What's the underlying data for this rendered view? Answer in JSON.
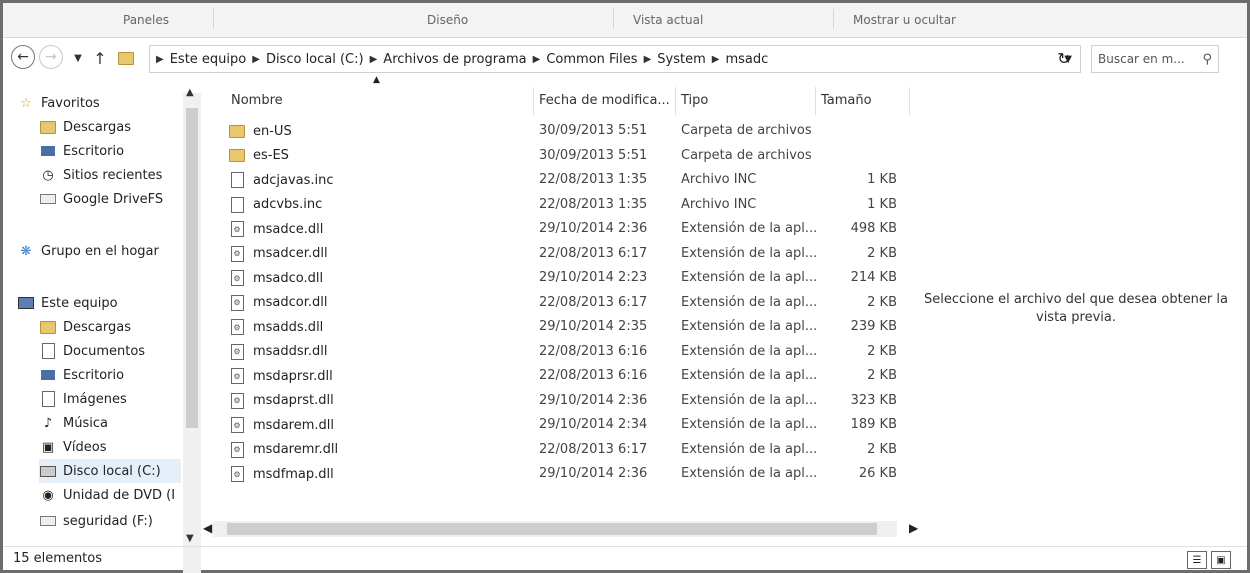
{
  "ribbon": {
    "groups": [
      "Paneles",
      "Diseño",
      "Vista actual",
      "Mostrar u ocultar"
    ]
  },
  "address": {
    "segments": [
      "Este equipo",
      "Disco local (C:)",
      "Archivos de programa",
      "Common Files",
      "System",
      "msadc"
    ],
    "search_placeholder": "Buscar en m..."
  },
  "sidebar": {
    "favorites_label": "Favoritos",
    "favorites": [
      "Descargas",
      "Escritorio",
      "Sitios recientes",
      "Google DriveFS"
    ],
    "homegroup_label": "Grupo en el hogar",
    "pc_label": "Este equipo",
    "pc_items": [
      "Descargas",
      "Documentos",
      "Escritorio",
      "Imágenes",
      "Música",
      "Vídeos",
      "Disco local (C:)",
      "Unidad de DVD (I",
      "seguridad (F:)"
    ]
  },
  "columns": {
    "name": "Nombre",
    "date": "Fecha de modifica...",
    "type": "Tipo",
    "size": "Tamaño"
  },
  "files": [
    {
      "name": "en-US",
      "date": "30/09/2013 5:51",
      "type": "Carpeta de archivos",
      "size": "",
      "icon": "folder-icon"
    },
    {
      "name": "es-ES",
      "date": "30/09/2013 5:51",
      "type": "Carpeta de archivos",
      "size": "",
      "icon": "folder-icon"
    },
    {
      "name": "adcjavas.inc",
      "date": "22/08/2013 1:35",
      "type": "Archivo INC",
      "size": "1 KB",
      "icon": "file-icon"
    },
    {
      "name": "adcvbs.inc",
      "date": "22/08/2013 1:35",
      "type": "Archivo INC",
      "size": "1 KB",
      "icon": "file-icon"
    },
    {
      "name": "msadce.dll",
      "date": "29/10/2014 2:36",
      "type": "Extensión de la apl...",
      "size": "498 KB",
      "icon": "dll-icon"
    },
    {
      "name": "msadcer.dll",
      "date": "22/08/2013 6:17",
      "type": "Extensión de la apl...",
      "size": "2 KB",
      "icon": "dll-icon"
    },
    {
      "name": "msadco.dll",
      "date": "29/10/2014 2:23",
      "type": "Extensión de la apl...",
      "size": "214 KB",
      "icon": "dll-icon"
    },
    {
      "name": "msadcor.dll",
      "date": "22/08/2013 6:17",
      "type": "Extensión de la apl...",
      "size": "2 KB",
      "icon": "dll-icon"
    },
    {
      "name": "msadds.dll",
      "date": "29/10/2014 2:35",
      "type": "Extensión de la apl...",
      "size": "239 KB",
      "icon": "dll-icon"
    },
    {
      "name": "msaddsr.dll",
      "date": "22/08/2013 6:16",
      "type": "Extensión de la apl...",
      "size": "2 KB",
      "icon": "dll-icon"
    },
    {
      "name": "msdaprsr.dll",
      "date": "22/08/2013 6:16",
      "type": "Extensión de la apl...",
      "size": "2 KB",
      "icon": "dll-icon"
    },
    {
      "name": "msdaprst.dll",
      "date": "29/10/2014 2:36",
      "type": "Extensión de la apl...",
      "size": "323 KB",
      "icon": "dll-icon"
    },
    {
      "name": "msdarem.dll",
      "date": "29/10/2014 2:34",
      "type": "Extensión de la apl...",
      "size": "189 KB",
      "icon": "dll-icon"
    },
    {
      "name": "msdaremr.dll",
      "date": "22/08/2013 6:17",
      "type": "Extensión de la apl...",
      "size": "2 KB",
      "icon": "dll-icon"
    },
    {
      "name": "msdfmap.dll",
      "date": "29/10/2014 2:36",
      "type": "Extensión de la apl...",
      "size": "26 KB",
      "icon": "dll-icon"
    }
  ],
  "preview_text": "Seleccione el archivo del que desea obtener la vista previa.",
  "status": {
    "count": "15 elementos"
  }
}
